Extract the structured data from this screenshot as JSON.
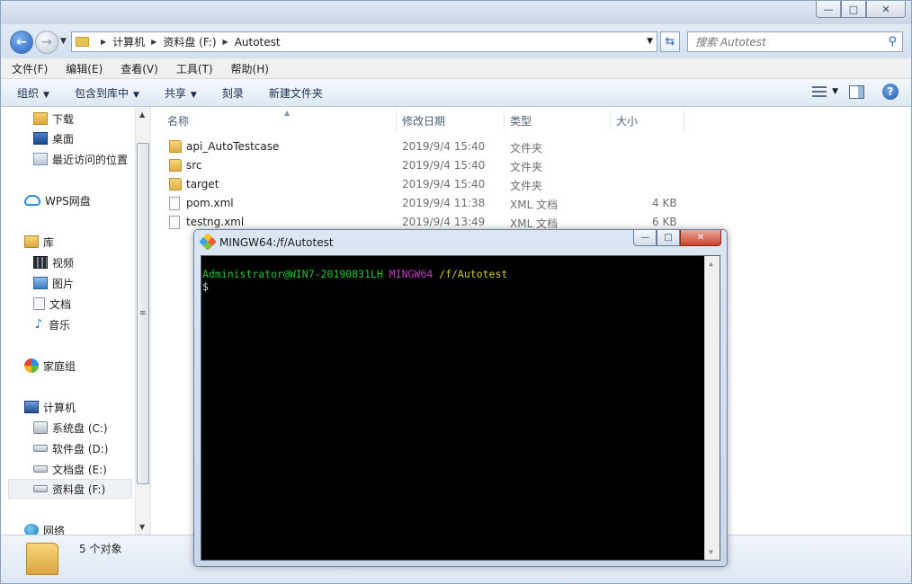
{
  "window": {
    "minimize": "—",
    "maximize": "□",
    "close": "✕"
  },
  "address": {
    "crumbs": [
      "计算机",
      "资料盘 (F:)",
      "Autotest"
    ],
    "search_placeholder": "搜索 Autotest"
  },
  "menubar": {
    "items": [
      "文件(F)",
      "编辑(E)",
      "查看(V)",
      "工具(T)",
      "帮助(H)"
    ]
  },
  "toolbar": {
    "organize": "组织",
    "include_in_library": "包含到库中",
    "share": "共享",
    "burn": "刻录",
    "new_folder": "新建文件夹",
    "help": "?"
  },
  "nav": {
    "favorites": [
      "下载",
      "桌面",
      "最近访问的位置"
    ],
    "wps": "WPS网盘",
    "library": "库",
    "library_items": [
      "视频",
      "图片",
      "文档",
      "音乐"
    ],
    "homegroup": "家庭组",
    "computer": "计算机",
    "drives": [
      "系统盘 (C:)",
      "软件盘 (D:)",
      "文档盘 (E:)",
      "资料盘 (F:)"
    ],
    "network": "网络"
  },
  "filelist": {
    "columns": [
      "名称",
      "修改日期",
      "类型",
      "大小"
    ],
    "rows": [
      {
        "name": "api_AutoTestcase",
        "date": "2019/9/4 15:40",
        "type": "文件夹",
        "size": ""
      },
      {
        "name": "src",
        "date": "2019/9/4 15:40",
        "type": "文件夹",
        "size": ""
      },
      {
        "name": "target",
        "date": "2019/9/4 15:40",
        "type": "文件夹",
        "size": ""
      },
      {
        "name": "pom.xml",
        "date": "2019/9/4 11:38",
        "type": "XML 文档",
        "size": "4 KB"
      },
      {
        "name": "testng.xml",
        "date": "2019/9/4 13:49",
        "type": "XML 文档",
        "size": "6 KB"
      }
    ]
  },
  "status": {
    "count": "5 个对象"
  },
  "terminal": {
    "title": "MINGW64:/f/Autotest",
    "user": "Administrator@WIN7-20190831LH",
    "env": "MINGW64",
    "path": "/f/Autotest",
    "prompt": "$"
  },
  "colors": {
    "term_user": "#22c72c",
    "term_env": "#c43bc4",
    "term_path": "#c8c825"
  }
}
